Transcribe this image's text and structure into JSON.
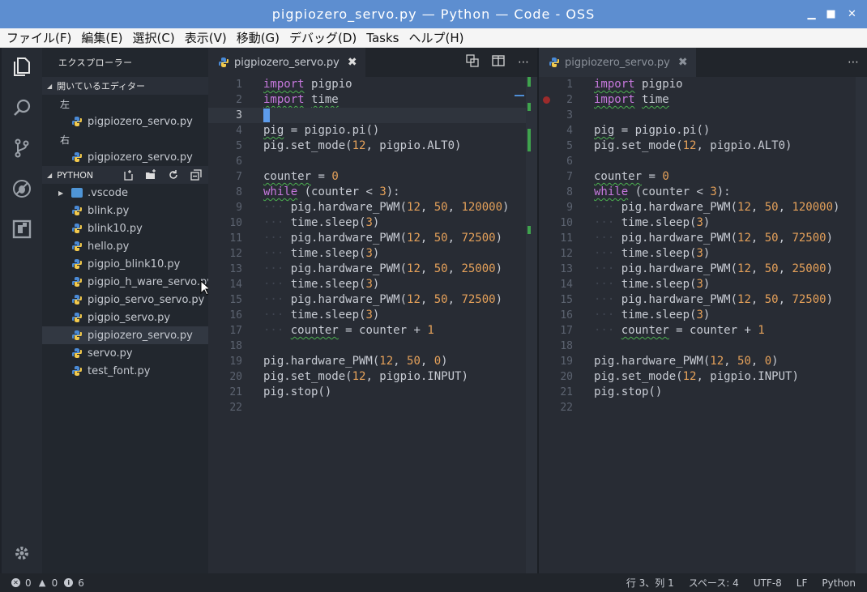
{
  "window": {
    "title": "pigpiozero_servo.py — Python — Code - OSS"
  },
  "menu": [
    "ファイル(F)",
    "編集(E)",
    "選択(C)",
    "表示(V)",
    "移動(G)",
    "デバッグ(D)",
    "Tasks",
    "ヘルプ(H)"
  ],
  "activity_bar": [
    "explorer-icon",
    "search-icon",
    "source-control-icon",
    "debug-icon",
    "extensions-icon",
    "gear-icon"
  ],
  "sidebar": {
    "title": "エクスプローラー",
    "open_editors": {
      "header": "開いているエディター",
      "groups": [
        {
          "name": "左",
          "files": [
            "pigpiozero_servo.py"
          ]
        },
        {
          "name": "右",
          "files": [
            "pigpiozero_servo.py"
          ]
        }
      ]
    },
    "folder": {
      "header": "PYTHON",
      "items": [
        ".vscode",
        "blink.py",
        "blink10.py",
        "hello.py",
        "pigpio_blink10.py",
        "pigpio_h_ware_servo.py",
        "pigpio_servo_servo.py",
        "pigpio_servo.py",
        "pigpiozero_servo.py",
        "servo.py",
        "test_font.py"
      ],
      "selected": "pigpiozero_servo.py"
    }
  },
  "editor_left": {
    "tab": "pigpiozero_servo.py",
    "active": true
  },
  "editor_right": {
    "tab": "pigpiozero_servo.py",
    "active": false
  },
  "code_lines": [
    "import pigpio",
    "import time",
    "",
    "pig = pigpio.pi()",
    "pig.set_mode(12, pigpio.ALT0)",
    "",
    "counter = 0",
    "while (counter < 3):",
    "    pig.hardware_PWM(12, 50, 120000)",
    "    time.sleep(3)",
    "    pig.hardware_PWM(12, 50, 72500)",
    "    time.sleep(3)",
    "    pig.hardware_PWM(12, 50, 25000)",
    "    time.sleep(3)",
    "    pig.hardware_PWM(12, 50, 72500)",
    "    time.sleep(3)",
    "    counter = counter + 1",
    "",
    "pig.hardware_PWM(12, 50, 0)",
    "pig.set_mode(12, pigpio.INPUT)",
    "pig.stop()",
    ""
  ],
  "status": {
    "errors": "0",
    "warnings": "0",
    "infos": "6",
    "position": "行 3、列 1",
    "indent": "スペース: 4",
    "encoding": "UTF-8",
    "eol": "LF",
    "language": "Python"
  },
  "colors": {
    "title_bar": "#5d8ed0",
    "keyword": "#c678dd",
    "number": "#e5a15a",
    "git_added": "#3fa34d",
    "breakpoint": "#9c2b2b"
  }
}
